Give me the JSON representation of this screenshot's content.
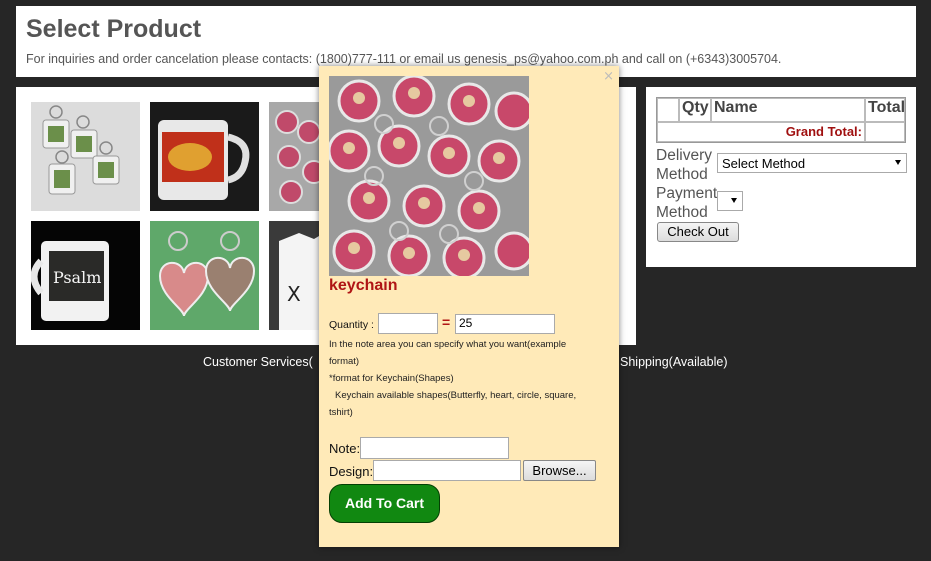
{
  "header": {
    "title": "Select Product",
    "subtitle": "For inquiries and order cancelation please contacts: (1800)777-111 or email us genesis_ps@yahoo.com.ph and call on (+6343)3005704."
  },
  "products": [
    {
      "name": "keychain-tshirt"
    },
    {
      "name": "mug-red"
    },
    {
      "name": "keychain-round"
    },
    {
      "name": "mug-psalm"
    },
    {
      "name": "keychain-heart"
    },
    {
      "name": "tshirt"
    }
  ],
  "cart": {
    "col_qty": "Qty",
    "col_name": "Name",
    "col_total": "Total",
    "grand_total_label": "Grand Total:",
    "delivery_label_1": "Delivery",
    "delivery_label_2": "Method",
    "delivery_selected": "Select Method",
    "payment_label_1": "Payment",
    "payment_label_2": "Method",
    "checkout_label": "Check Out"
  },
  "footer": {
    "left": "Customer Services(",
    "right": "Shipping(Available)"
  },
  "modal": {
    "close_symbol": "×",
    "product_name": "keychain",
    "quantity_label": "Quantity :",
    "quantity_value": "",
    "equals": "=",
    "total_value": "25",
    "note_line1": "In the note area you can specify what you want(example",
    "note_line2": "format)",
    "note_line3": "*format for Keychain(Shapes)",
    "note_line4": "Keychain available shapes(Butterfly, heart, circle, square,",
    "note_line5": "tshirt)",
    "note_label": "Note:",
    "note_value": "",
    "design_label": "Design:",
    "design_value": "",
    "browse_label": "Browse...",
    "add_to_cart_label": "Add To Cart"
  },
  "colors": {
    "page_bg": "#262626",
    "modal_bg": "#ffeab8",
    "product_name": "#b01515",
    "grand_total": "#a01010",
    "add_to_cart": "#118811"
  }
}
